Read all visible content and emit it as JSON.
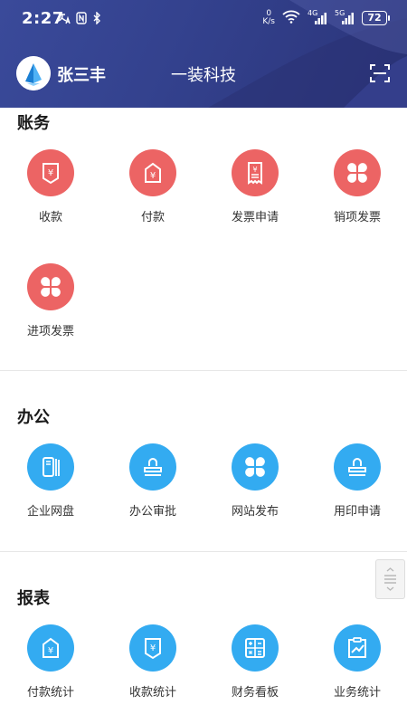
{
  "status_bar": {
    "time": "2:27",
    "net_speed_value": "0",
    "net_speed_unit": "K/s",
    "signal1_label": "4G",
    "signal2_label": "5G",
    "battery": "72"
  },
  "header": {
    "user_name": "张三丰",
    "company_name": "一装科技"
  },
  "sections": {
    "finance": {
      "title": "账务",
      "items": [
        {
          "label": "收款",
          "icon": "receipt-yen-icon",
          "color": "#ec6464"
        },
        {
          "label": "付款",
          "icon": "payment-yen-icon",
          "color": "#ec6464"
        },
        {
          "label": "发票申请",
          "icon": "invoice-request-icon",
          "color": "#ec6464"
        },
        {
          "label": "销项发票",
          "icon": "clover-icon",
          "color": "#ec6464"
        },
        {
          "label": "进项发票",
          "icon": "clover-icon",
          "color": "#ec6464"
        }
      ]
    },
    "office": {
      "title": "办公",
      "items": [
        {
          "label": "企业网盘",
          "icon": "cloud-drive-icon",
          "color": "#33abf1"
        },
        {
          "label": "办公审批",
          "icon": "approval-stamp-icon",
          "color": "#33abf1"
        },
        {
          "label": "网站发布",
          "icon": "clover-icon",
          "color": "#33abf1"
        },
        {
          "label": "用印申请",
          "icon": "seal-stamp-icon",
          "color": "#33abf1"
        }
      ]
    },
    "reports": {
      "title": "报表",
      "items": [
        {
          "label": "付款统计",
          "icon": "payment-yen-icon",
          "color": "#33abf1"
        },
        {
          "label": "收款统计",
          "icon": "receipt-yen-icon",
          "color": "#33abf1"
        },
        {
          "label": "财务看板",
          "icon": "calculator-icon",
          "color": "#33abf1"
        },
        {
          "label": "业务统计",
          "icon": "trend-chart-icon",
          "color": "#33abf1"
        }
      ]
    }
  }
}
